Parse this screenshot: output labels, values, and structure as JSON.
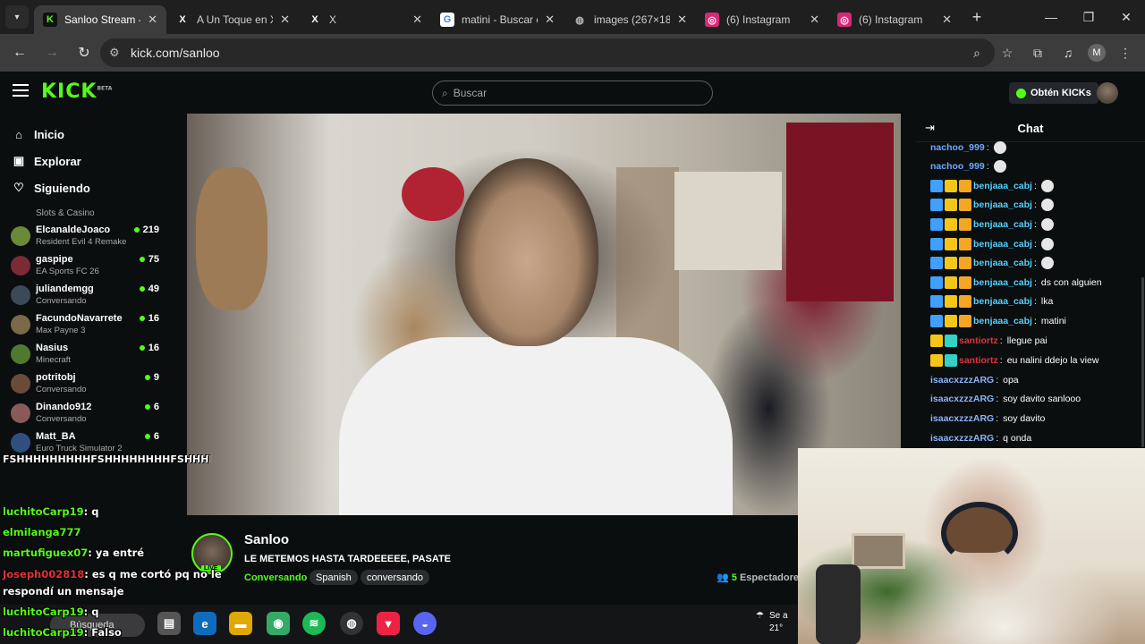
{
  "browser": {
    "tabs": [
      {
        "title": "Sanloo Stream -",
        "fav": "K",
        "fav_color": "#53fc18",
        "fav_bg": "#111",
        "active": true
      },
      {
        "title": "A Un Toque en X",
        "fav": "X",
        "fav_color": "#fff",
        "fav_bg": "#1f1f1f",
        "active": false
      },
      {
        "title": "X",
        "fav": "X",
        "fav_color": "#fff",
        "fav_bg": "#1f1f1f",
        "active": false
      },
      {
        "title": "matini - Buscar c",
        "fav": "G",
        "fav_color": "#4285f4",
        "fav_bg": "#fff",
        "active": false
      },
      {
        "title": "images (267×18",
        "fav": "◍",
        "fav_color": "#bbb",
        "fav_bg": "#1f1f1f",
        "active": false
      },
      {
        "title": "(6) Instagram",
        "fav": "◎",
        "fav_color": "#fff",
        "fav_bg": "#d62976",
        "active": false
      },
      {
        "title": "(6) Instagram",
        "fav": "◎",
        "fav_color": "#fff",
        "fav_bg": "#d62976",
        "active": false
      }
    ],
    "url": "kick.com/sanloo",
    "profile_initial": "M"
  },
  "kick": {
    "logo": "KICK",
    "logo_sup": "BETA",
    "search_placeholder": "Buscar",
    "get_kicks": "Obtén KICKs"
  },
  "sidebar": {
    "nav": [
      {
        "label": "Inicio",
        "icon": "home-icon"
      },
      {
        "label": "Explorar",
        "icon": "explore-icon"
      },
      {
        "label": "Siguiendo",
        "icon": "heart-icon"
      }
    ],
    "top_category": "Slots & Casino",
    "channels": [
      {
        "name": "ElcanaldeJoaco",
        "game": "Resident Evil 4 Remake",
        "viewers": "219",
        "color": "#6a8a3a"
      },
      {
        "name": "gaspipe",
        "game": "EA Sports FC 26",
        "viewers": "75",
        "color": "#7a2b35"
      },
      {
        "name": "juliandemgg",
        "game": "Conversando",
        "viewers": "49",
        "color": "#3c4a57"
      },
      {
        "name": "FacundoNavarrete",
        "game": "Max Payne 3",
        "viewers": "16",
        "color": "#7a6a48"
      },
      {
        "name": "Nasius",
        "game": "Minecraft",
        "viewers": "16",
        "color": "#4f7a2e"
      },
      {
        "name": "potritobj",
        "game": "Conversando",
        "viewers": "9",
        "color": "#6b4a3a"
      },
      {
        "name": "Dinando912",
        "game": "Conversando",
        "viewers": "6",
        "color": "#8a5a5a"
      },
      {
        "name": "Matt_BA",
        "game": "Euro Truck Simulator 2",
        "viewers": "6",
        "color": "#2f4f7f"
      }
    ]
  },
  "stream": {
    "name": "Sanloo",
    "title": "LE METEMOS HASTA TARDEEEEE, PASATE",
    "category": "Conversando",
    "tags": [
      "Spanish",
      "conversando"
    ],
    "live_label": "LIVE",
    "viewers_count": "5",
    "viewers_label": "Espectadores"
  },
  "chat": {
    "title": "Chat",
    "messages": [
      {
        "user": "nachoo_999",
        "text": "",
        "color": "#6fa8ff",
        "badges": [],
        "emote": true
      },
      {
        "user": "nachoo_999",
        "text": "",
        "color": "#6fa8ff",
        "badges": [],
        "emote": true
      },
      {
        "user": "benjaaa_cabj",
        "text": "",
        "color": "#53d1ff",
        "badges": [
          "#3fa0ff",
          "#f5c518",
          "#f5a623"
        ],
        "emote": true
      },
      {
        "user": "benjaaa_cabj",
        "text": "",
        "color": "#53d1ff",
        "badges": [
          "#3fa0ff",
          "#f5c518",
          "#f5a623"
        ],
        "emote": true
      },
      {
        "user": "benjaaa_cabj",
        "text": "",
        "color": "#53d1ff",
        "badges": [
          "#3fa0ff",
          "#f5c518",
          "#f5a623"
        ],
        "emote": true
      },
      {
        "user": "benjaaa_cabj",
        "text": "",
        "color": "#53d1ff",
        "badges": [
          "#3fa0ff",
          "#f5c518",
          "#f5a623"
        ],
        "emote": true
      },
      {
        "user": "benjaaa_cabj",
        "text": "",
        "color": "#53d1ff",
        "badges": [
          "#3fa0ff",
          "#f5c518",
          "#f5a623"
        ],
        "emote": true
      },
      {
        "user": "benjaaa_cabj",
        "text": "ds con alguien",
        "color": "#53d1ff",
        "badges": [
          "#3fa0ff",
          "#f5c518",
          "#f5a623"
        ],
        "emote": false
      },
      {
        "user": "benjaaa_cabj",
        "text": "lka",
        "color": "#53d1ff",
        "badges": [
          "#3fa0ff",
          "#f5c518",
          "#f5a623"
        ],
        "emote": false
      },
      {
        "user": "benjaaa_cabj",
        "text": "matini",
        "color": "#53d1ff",
        "badges": [
          "#3fa0ff",
          "#f5c518",
          "#f5a623"
        ],
        "emote": false
      },
      {
        "user": "santiortz",
        "text": "llegue pai",
        "color": "#e0323c",
        "badges": [
          "#f5c518",
          "#35d0c8"
        ],
        "emote": false
      },
      {
        "user": "santiortz",
        "text": "eu nalini ddejo la view",
        "color": "#e0323c",
        "badges": [
          "#f5c518",
          "#35d0c8"
        ],
        "emote": false
      },
      {
        "user": "isaacxzzzARG",
        "text": "opa",
        "color": "#8ab4f8",
        "badges": [],
        "emote": false
      },
      {
        "user": "isaacxzzzARG",
        "text": "soy davito sanlooo",
        "color": "#8ab4f8",
        "badges": [],
        "emote": false
      },
      {
        "user": "isaacxzzzARG",
        "text": "soy davito",
        "color": "#8ab4f8",
        "badges": [],
        "emote": false
      },
      {
        "user": "isaacxzzzARG",
        "text": "q onda",
        "color": "#8ab4f8",
        "badges": [],
        "emote": false
      }
    ]
  },
  "overlay": {
    "spam": "FSHHHHHHHHHFSHHHHHHHHFSHHHHHHHHFSHHHHHHHHFSHHHHHHHHFSHHHHHHHHFSHHHHHHHHFSHHHHHHHHFSHHHHHHHH",
    "lines": [
      {
        "user": "luchitoCarp19",
        "text": ": q",
        "cls": "g"
      },
      {
        "user": "elmilanga777",
        "text": "",
        "cls": "g"
      },
      {
        "user": "martufiguex07",
        "text": ": ya entré",
        "cls": "g"
      },
      {
        "user": "Joseph002818",
        "text": ": es q me cortó pq no le",
        "cls": "r"
      },
      {
        "user": "",
        "text": "respondí un mensaje",
        "cls": ""
      },
      {
        "user": "luchitoCarp19",
        "text": ": q",
        "cls": "g"
      },
      {
        "user": "luchitoCarp19",
        "text": ": Falso",
        "cls": "g"
      }
    ]
  },
  "taskbar": {
    "search": "Búsqueda",
    "weather_line1": "Se a",
    "weather_line2": "21°"
  }
}
